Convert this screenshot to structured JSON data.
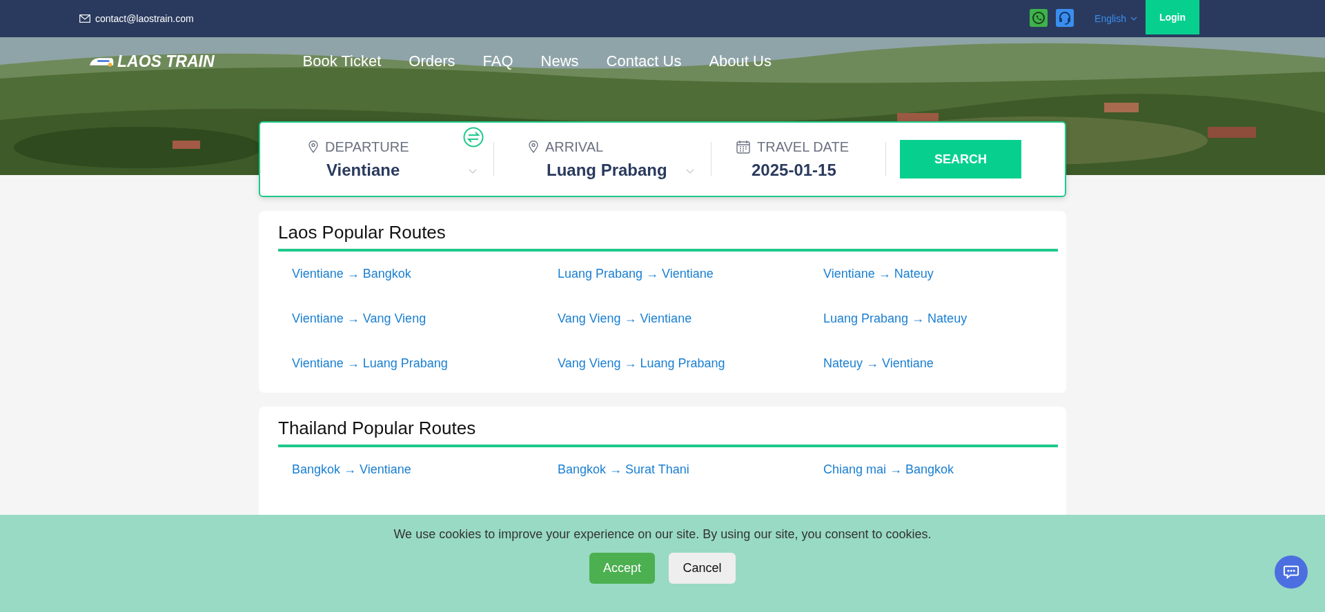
{
  "top_bar": {
    "email": "contact@laostrain.com",
    "language": "English",
    "login": "Login"
  },
  "header": {
    "logo": "LAOS TRAIN",
    "nav": [
      {
        "label": "Book Ticket"
      },
      {
        "label": "Orders"
      },
      {
        "label": "FAQ"
      },
      {
        "label": "News"
      },
      {
        "label": "Contact Us"
      },
      {
        "label": "About Us"
      }
    ]
  },
  "search_form": {
    "departure": {
      "label": "DEPARTURE",
      "value": "Vientiane"
    },
    "arrival": {
      "label": "ARRIVAL",
      "value": "Luang Prabang"
    },
    "date": {
      "label": "TRAVEL DATE",
      "value": "2025-01-15"
    },
    "button": "SEARCH"
  },
  "route_sections": [
    {
      "title": "Laos Popular Routes",
      "routes": [
        "Vientiane → Bangkok",
        "Luang Prabang → Vientiane",
        "Vientiane → Nateuy",
        "Vientiane → Vang Vieng",
        "Vang Vieng → Vientiane",
        "Luang Prabang → Nateuy",
        "Vientiane → Luang Prabang",
        "Vang Vieng → Luang Prabang",
        "Nateuy → Vientiane"
      ]
    },
    {
      "title": "Thailand Popular Routes",
      "routes": [
        "Bangkok → Vientiane",
        "Bangkok → Surat Thani",
        "Chiang mai → Bangkok"
      ]
    }
  ],
  "cookie_banner": {
    "message": "We use cookies to improve your experience on our site. By using our site, you consent to cookies.",
    "accept": "Accept",
    "cancel": "Cancel"
  }
}
